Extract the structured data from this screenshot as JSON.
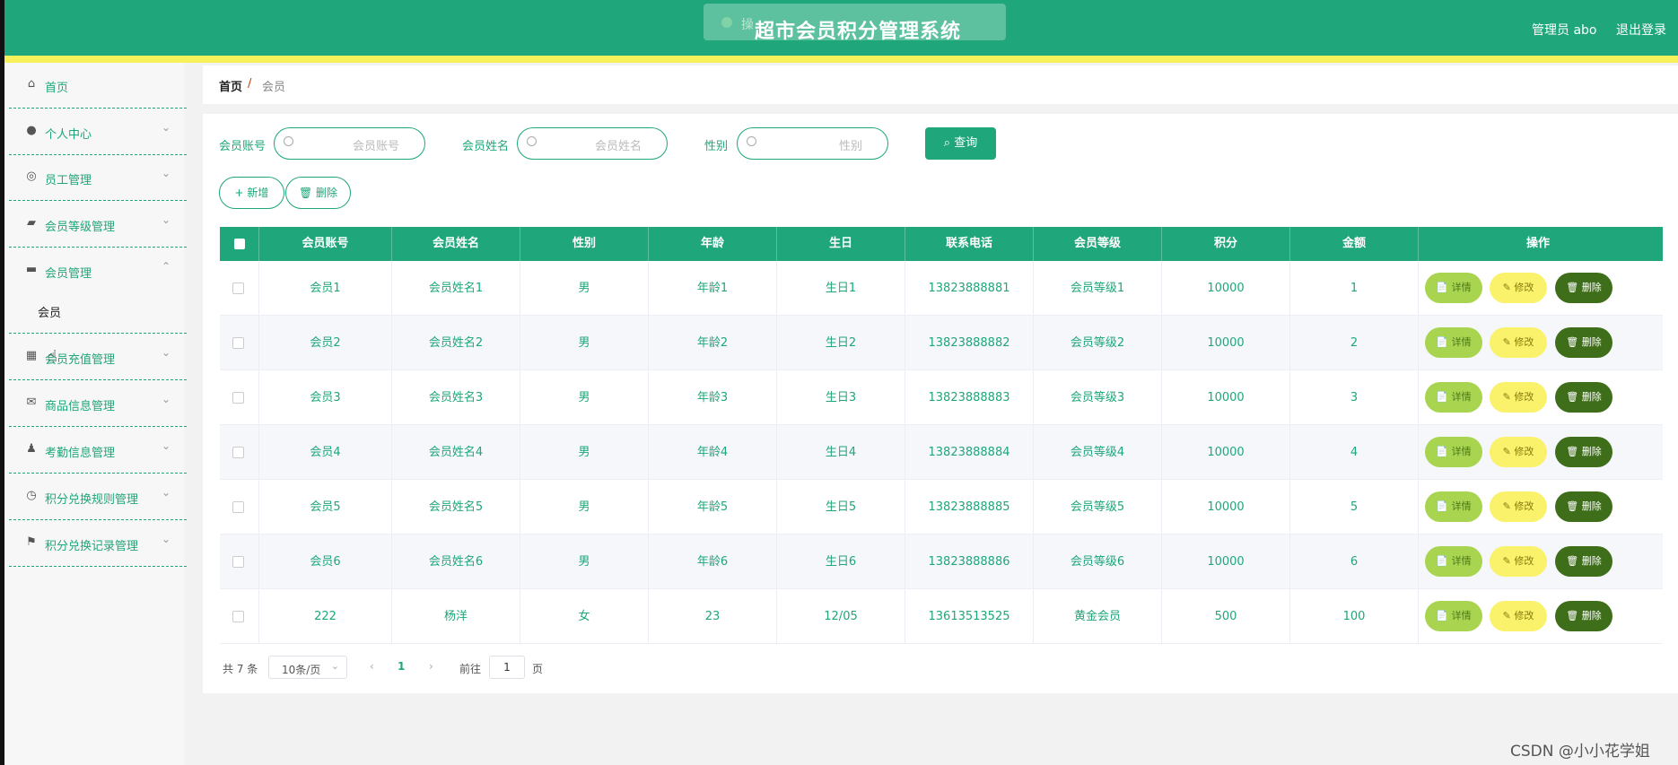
{
  "header": {
    "title": "超市会员积分管理系统",
    "toast_text": "操",
    "user_label": "管理员 abo",
    "logout_label": "退出登录"
  },
  "sidebar": {
    "items": [
      {
        "label": "首页",
        "icon": "home-icon"
      },
      {
        "label": "个人中心",
        "icon": "user-icon"
      },
      {
        "label": "员工管理",
        "icon": "staff-icon"
      },
      {
        "label": "会员等级管理",
        "icon": "chart-icon"
      },
      {
        "label": "会员管理",
        "icon": "chat-icon"
      },
      {
        "label": "会员",
        "icon": ""
      },
      {
        "label": "会员充值管理",
        "icon": "grid-icon"
      },
      {
        "label": "商品信息管理",
        "icon": "mail-icon"
      },
      {
        "label": "考勤信息管理",
        "icon": "person-icon"
      },
      {
        "label": "积分兑换规则管理",
        "icon": "clock-icon"
      },
      {
        "label": "积分兑换记录管理",
        "icon": "flag-icon"
      }
    ]
  },
  "breadcrumb": {
    "home": "首页",
    "separator": "/",
    "current": "会员"
  },
  "filters": {
    "account_label": "会员账号",
    "account_placeholder": "会员账号",
    "name_label": "会员姓名",
    "name_placeholder": "会员姓名",
    "gender_label": "性别",
    "gender_placeholder": "性别",
    "query_label": "查询"
  },
  "actions": {
    "add_label": "新增",
    "delete_label": "删除"
  },
  "table": {
    "columns": [
      "会员账号",
      "会员姓名",
      "性别",
      "年龄",
      "生日",
      "联系电话",
      "会员等级",
      "积分",
      "金额",
      "操作"
    ],
    "rows": [
      [
        "会员1",
        "会员姓名1",
        "男",
        "年龄1",
        "生日1",
        "13823888881",
        "会员等级1",
        "10000",
        "1"
      ],
      [
        "会员2",
        "会员姓名2",
        "男",
        "年龄2",
        "生日2",
        "13823888882",
        "会员等级2",
        "10000",
        "2"
      ],
      [
        "会员3",
        "会员姓名3",
        "男",
        "年龄3",
        "生日3",
        "13823888883",
        "会员等级3",
        "10000",
        "3"
      ],
      [
        "会员4",
        "会员姓名4",
        "男",
        "年龄4",
        "生日4",
        "13823888884",
        "会员等级4",
        "10000",
        "4"
      ],
      [
        "会员5",
        "会员姓名5",
        "男",
        "年龄5",
        "生日5",
        "13823888885",
        "会员等级5",
        "10000",
        "5"
      ],
      [
        "会员6",
        "会员姓名6",
        "男",
        "年龄6",
        "生日6",
        "13823888886",
        "会员等级6",
        "10000",
        "6"
      ],
      [
        "222",
        "杨洋",
        "女",
        "23",
        "12/05",
        "13613513525",
        "黄金会员",
        "500",
        "100"
      ]
    ],
    "row_actions": {
      "detail": "详情",
      "edit": "修改",
      "delete": "删除"
    }
  },
  "pagination": {
    "total_text": "共 7 条",
    "page_size": "10条/页",
    "current_page": "1",
    "goto_label": "前往",
    "goto_value": "1",
    "page_unit": "页"
  },
  "watermark": "CSDN @小小花学姐",
  "colors": {
    "primary": "#1fa67a",
    "accent_stripe": "#f6f15b",
    "detail_btn": "#a8d44f",
    "edit_btn": "#f9f26a",
    "delete_btn": "#3f6e1a"
  }
}
